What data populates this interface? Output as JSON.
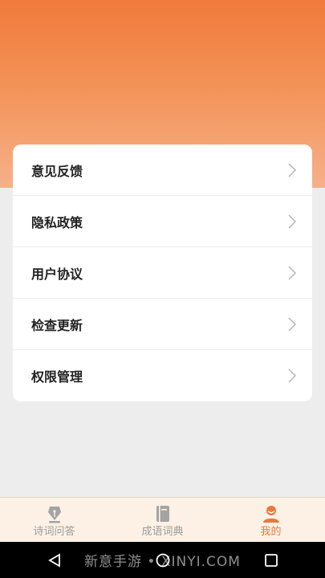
{
  "menu": {
    "items": [
      {
        "label": "意见反馈"
      },
      {
        "label": "隐私政策"
      },
      {
        "label": "用户协议"
      },
      {
        "label": "检查更新"
      },
      {
        "label": "权限管理"
      }
    ]
  },
  "tabbar": {
    "tabs": [
      {
        "label": "诗词问答",
        "icon": "pen-nib-icon",
        "active": false
      },
      {
        "label": "成语词典",
        "icon": "book-icon",
        "active": false
      },
      {
        "label": "我的",
        "icon": "user-icon",
        "active": true
      }
    ]
  },
  "colors": {
    "accent": "#e8793d",
    "header_top": "#f07a3b",
    "header_bottom": "#f6b089",
    "tab_inactive": "#9a9a9a",
    "tabbar_bg": "#fdf1e6"
  },
  "watermark": {
    "text": "新意手游 • XINYI.COM"
  }
}
